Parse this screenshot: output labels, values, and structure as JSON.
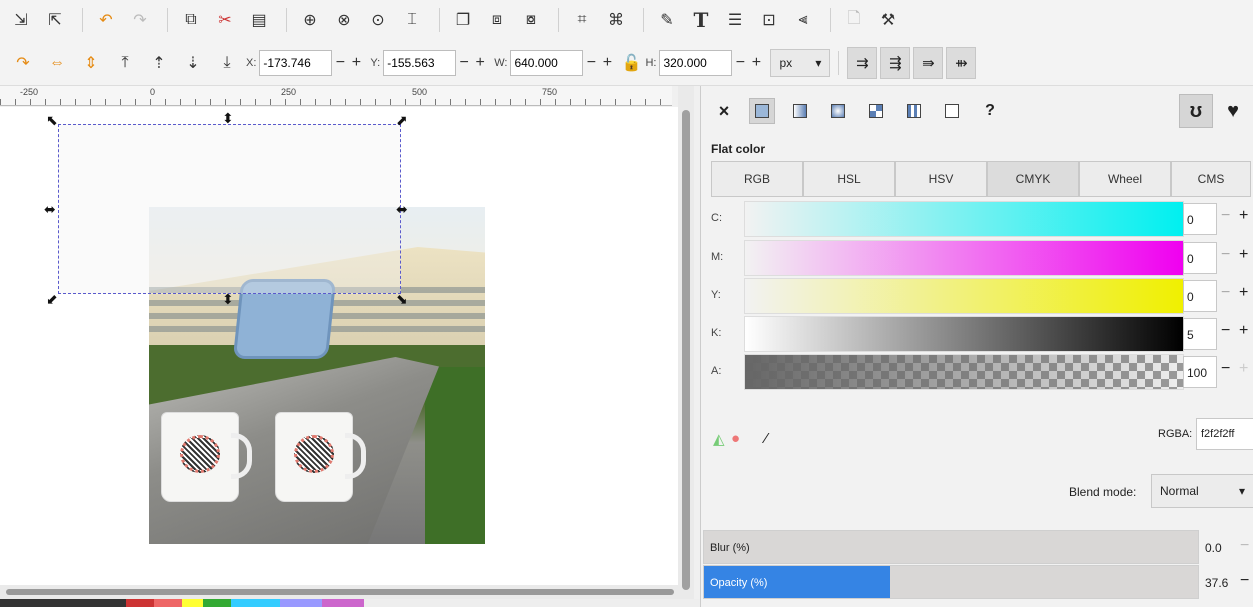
{
  "commands": {
    "icons": [
      "import-icon",
      "export-icon",
      "undo-icon",
      "redo-icon",
      "duplicate-icon",
      "cut-icon",
      "paste-icon",
      "zoom-selection-icon",
      "zoom-drawing-icon",
      "zoom-page-icon",
      "zoom-page-width-icon",
      "duplicate-object-icon",
      "clone-icon",
      "unlink-clone-icon",
      "group-icon",
      "ungroup-icon",
      "fill-stroke-icon",
      "text-font-icon",
      "layers-icon",
      "xml-editor-icon",
      "align-icon",
      "document-properties-icon",
      "preferences-icon"
    ]
  },
  "controls": {
    "x_label": "X:",
    "x_value": "-173.746",
    "y_label": "Y:",
    "y_value": "-155.563",
    "w_label": "W:",
    "w_value": "640.000",
    "h_label": "H:",
    "h_value": "320.000",
    "minus": "−",
    "plus": "+",
    "unit": "px",
    "lock_icon": "lock-open-icon"
  },
  "ruler": {
    "labels": [
      "-250",
      "0",
      "250",
      "500",
      "750"
    ]
  },
  "fill_panel": {
    "close": "×",
    "unset": "?",
    "flat_color_title": "Flat color",
    "tabs": [
      "RGB",
      "HSL",
      "HSV",
      "CMYK",
      "Wheel",
      "CMS"
    ],
    "active_tab": "CMYK",
    "channels": [
      {
        "label": "C:",
        "value": "0",
        "from": "#f2f2f2",
        "to": "#00f0f0"
      },
      {
        "label": "M:",
        "value": "0",
        "from": "#f2f2f2",
        "to": "#f000f0"
      },
      {
        "label": "Y:",
        "value": "0",
        "from": "#f2f2f2",
        "to": "#f0f000"
      },
      {
        "label": "K:",
        "value": "5",
        "from": "#ffffff",
        "to": "#000000"
      },
      {
        "label": "A:",
        "value": "100",
        "from": "#666666",
        "to": "#f2f2f2"
      }
    ],
    "rgba_label": "RGBA:",
    "rgba_value": "f2f2f2ff",
    "blend_label": "Blend mode:",
    "blend_value": "Normal",
    "blur_label": "Blur (%)",
    "blur_value": "0.0",
    "opacity_label": "Opacity (%)",
    "opacity_value": "37.6",
    "opacity_fraction": 0.376
  }
}
